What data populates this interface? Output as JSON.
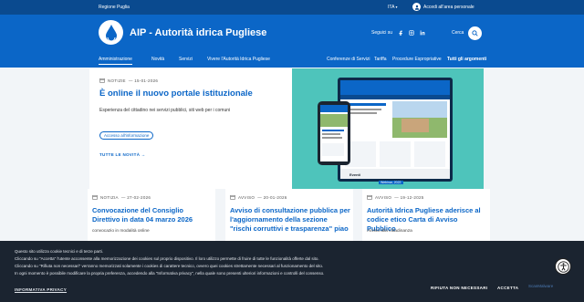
{
  "topbar": {
    "region": "Regione Puglia",
    "lang": "ITA",
    "login": "Accedi all'area personale"
  },
  "header": {
    "brand": "AIP - Autorità idrica Pugliese",
    "follow": "Seguici su",
    "search": "Cerca"
  },
  "nav": {
    "left": [
      "Amministrazione",
      "Novità",
      "Servizi",
      "Vivere l'Autorità Idrica Pugliese"
    ],
    "right": [
      "Conferenze di Servizi",
      "Tariffa",
      "Procedure Espropriative",
      "Tutti gli argomenti"
    ]
  },
  "hero": {
    "tag": "NOTIZIE",
    "date": "— 15-01-2026",
    "title": "È online il nuovo portale istituzionale",
    "text": "Esperienza del cittadino nei servizi pubblici, siti web per i comuni",
    "pill": "Accesso all'informazione",
    "all_news": "TUTTE LE NOVITÀ →"
  },
  "mockup": {
    "events": "Eventi",
    "badge": "Webinar, 2022"
  },
  "cards": [
    {
      "tag": "NOTIZIA",
      "date": "— 27-02-2026",
      "title": "Convocazione del Consiglio Direttivo in data 04 marzo 2026",
      "sub": "convocazio in modalità online"
    },
    {
      "tag": "AVVISO",
      "date": "— 20-01-2026",
      "title": "Avviso di consultazione pubblica per l'aggiornamento della sezione \"rischi corruttivi e trasparenza\" piao",
      "sub": ""
    },
    {
      "tag": "AVVISO",
      "date": "— 19-12-2025",
      "title": "Autorità Idrica Pugliese aderisce al codice etico Carta di Avviso Pubblico",
      "sub": "Avviso alla cittadinanza"
    }
  ],
  "cookie": {
    "lines": [
      "Questo sito utilizza cookie tecnici e di terze parti.",
      "Cliccando su \"Accetta\" l'utente acconsente alla memorizzazione dei cookies sul proprio dispositivo. Il loro utilizzo permette di fruire di tutte le funzionalità offerte dal sito.",
      "Cliccando su \"Rifiuta non necessari\" verranno memorizzati solamente i cookies di carattere tecnico, ovvero quei cookies strettamente necessari al funzionamento del sito.",
      "In ogni momento è possibile modificare la propria preferenza, accedendo alla \"Informativa privacy\", nella quale sono presenti ulteriori informazioni e controlli del consenso."
    ],
    "privacy": "INFORMATIVA PRIVACY",
    "reject": "RIFIUTA NON NECESSARI",
    "accept": "ACCETTA"
  },
  "watermark": "ScanMalware",
  "colors": {
    "primary": "#0b66c7",
    "topbar": "#0a4a8f",
    "cookie_bg": "#1b2430",
    "hero_img": "#4ec4bb"
  }
}
